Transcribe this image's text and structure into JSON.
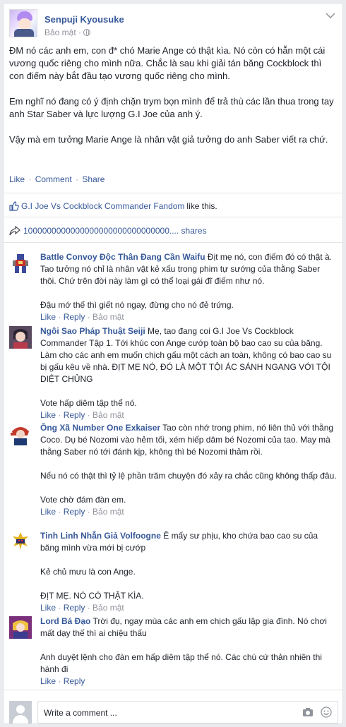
{
  "post": {
    "author": "Senpuji Kyousuke",
    "privacy": "Bảo mật ·",
    "paragraphs": [
      "ĐM nó các anh em, con đ* chó Marie Ange có thật kìa. Nó còn có hẵn một cái vương quốc riêng cho mình nữa. Chắc là sau khi giải tán băng Cockblock thì con điếm này bắt đầu tạo vương quốc riêng cho mình.",
      "Em nghĩ nó đang có ý định chặn trym bọn mình để trả thù các lần thua trong tay anh Star Saber và lực lượng G.I Joe của anh ý.",
      "Vậy mà em tưởng Marie Ange là nhân vật giả tưởng do anh Saber viết ra chứ."
    ],
    "actions": {
      "like": "Like",
      "sep": "·",
      "comment": "Comment",
      "share": "Share"
    }
  },
  "likes": {
    "page": "G.I Joe Vs Cockblock Commander Fandom",
    "suffix": " like this."
  },
  "shares": {
    "label": "1000000000000000000000000000000.... shares"
  },
  "comments": [
    {
      "name": "Battle Convoy Độc Thân Đang Cần Waifu",
      "text": " Địt mẹ nó, con điếm đó có thật à. Tao tưởng nó chỉ là nhân vật kẻ xấu trong phim tự sướng của thằng Saber thôi. Chứ trên đời này làm gì có thể loại gái đĩ điếm như nó.\n\nĐậu mớ thế thì giết nó ngay, đừng cho nó đẻ trứng.",
      "like": "Like",
      "reply": "Reply",
      "privacy": "Bảo mật"
    },
    {
      "name": "Ngôi Sao Pháp Thuật Seiji",
      "text": " Mẹ, tao đang coi G.I Joe Vs Cockblock Commander Tập 1. Tới khúc con Ange cướp toàn bộ bao cao su của băng. Làm cho các anh em muốn chịch gấu một cách an toàn, không có bao cao su bị gấu kêu về nhà. ĐỊT MẸ NÓ, ĐÓ LÀ MỘT TỘI ÁC SÁNH NGANG VỚI TỘI DIỆT CHỦNG\n\nVote hấp diêm tập thể nó.",
      "like": "Like",
      "reply": "Reply",
      "privacy": "Bảo mật"
    },
    {
      "name": "Ông Xã Number One Exkaiser",
      "text": " Tao còn nhớ trong phim, nó liên thủ với thằng Coco. Dụ bé Nozomi vào hẻm tối, xém hiếp dâm bé Nozomi của tao. May mà thằng Saber nó tới đánh kịp, không thì bé Nozomi thảm rồi.\n\nNếu nó có thật thì tỷ lệ phần trăm chuyện đó xảy ra chắc cũng không thấp đâu.\n\nVote chờ đám đàn em.",
      "like": "Like",
      "reply": "Reply",
      "privacy": "Bảo mật"
    },
    {
      "name": "Tinh Linh Nhẫn Giả Volfoogne",
      "text": " Ê mấy sư phịu, kho chứa bao cao su của băng mình vừa mới bị cướp\n\nKẻ chủ mưu là con Ange.\n\nĐỊT MẸ. NÓ CÓ THẬT KÌA.",
      "like": "Like",
      "reply": "Reply",
      "privacy": "Bảo mật"
    },
    {
      "name": "Lord Bá Đạo",
      "text": " Trời đụ, ngay mùa các anh em chịch gấu lập gia đình. Nó chơi mất dạy thế thì ai chiệu thấu\n\nAnh duyệt lệnh cho đàn em hấp diêm tập thể nó. Các chú cứ thản nhiên thi hành đi",
      "like": "Like",
      "reply": "Reply",
      "privacy": ""
    }
  ],
  "reply_box": {
    "placeholder": "Write a comment ..."
  }
}
